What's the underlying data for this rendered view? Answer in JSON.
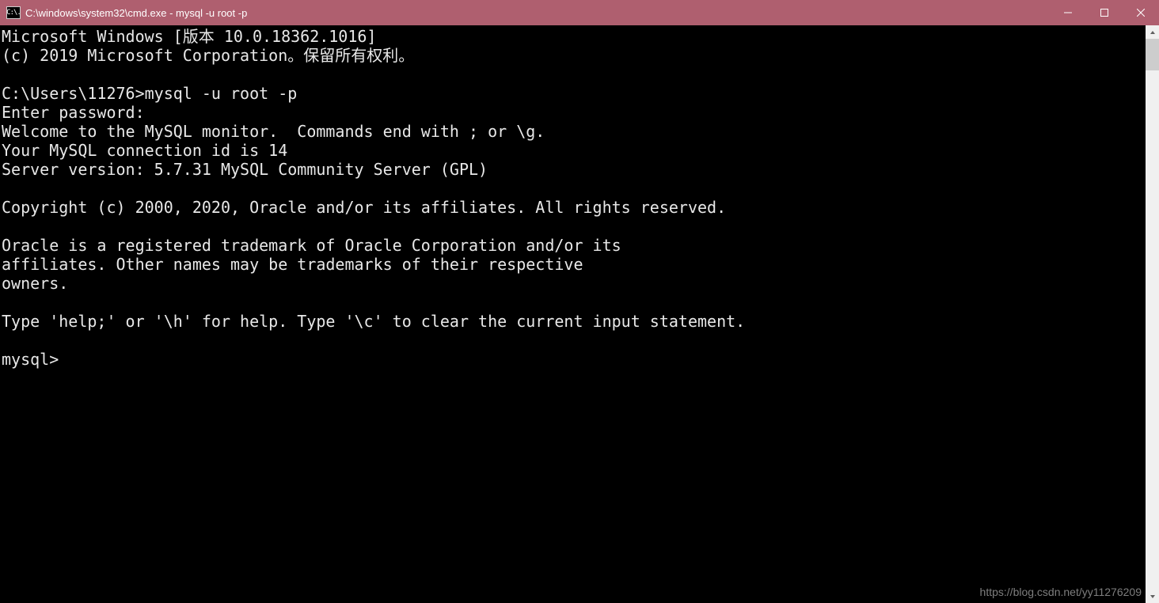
{
  "window": {
    "icon_text": "C:\\.",
    "title": "C:\\windows\\system32\\cmd.exe - mysql  -u root -p"
  },
  "terminal": {
    "lines": [
      "Microsoft Windows [版本 10.0.18362.1016]",
      "(c) 2019 Microsoft Corporation。保留所有权利。",
      "",
      "C:\\Users\\11276>mysql -u root -p",
      "Enter password:",
      "Welcome to the MySQL monitor.  Commands end with ; or \\g.",
      "Your MySQL connection id is 14",
      "Server version: 5.7.31 MySQL Community Server (GPL)",
      "",
      "Copyright (c) 2000, 2020, Oracle and/or its affiliates. All rights reserved.",
      "",
      "Oracle is a registered trademark of Oracle Corporation and/or its",
      "affiliates. Other names may be trademarks of their respective",
      "owners.",
      "",
      "Type 'help;' or '\\h' for help. Type '\\c' to clear the current input statement.",
      "",
      "mysql>"
    ]
  },
  "watermark": "https://blog.csdn.net/yy11276209"
}
